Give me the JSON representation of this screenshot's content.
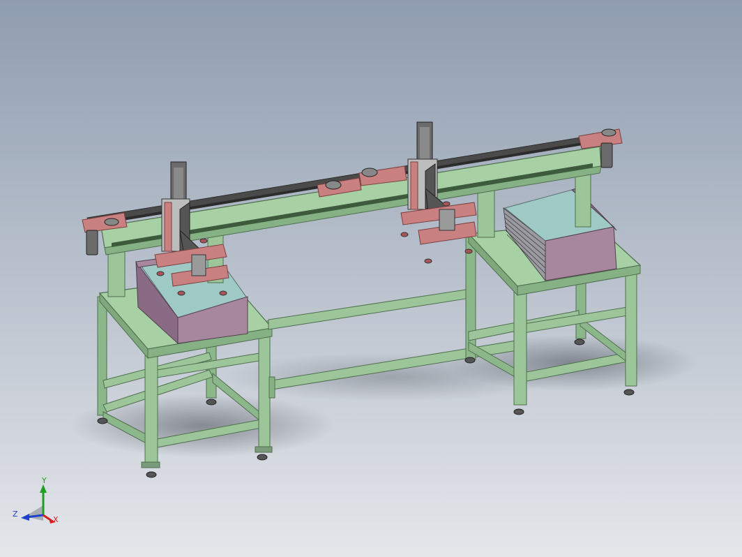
{
  "triad": {
    "x_label": "X",
    "y_label": "Y",
    "z_label": "Z"
  },
  "colors": {
    "background_top": "#8f9db0",
    "background_bottom": "#e4e6ea",
    "frame_green": "#9cc69a",
    "frame_green_dark": "#6d9a6c",
    "bracket_red": "#c98080",
    "bracket_red_dark": "#a65656",
    "bin_purple": "#a6879e",
    "bin_purple_dark": "#8a6b85",
    "plate_teal": "#9fc9c5",
    "motor_gray": "#6b6b6b",
    "belt_dark": "#3a3a3a",
    "axis_x": "#d62020",
    "axis_y": "#20a020",
    "axis_z": "#2040d0"
  },
  "icons": {
    "view_triad": "coordinate-triad-icon"
  }
}
